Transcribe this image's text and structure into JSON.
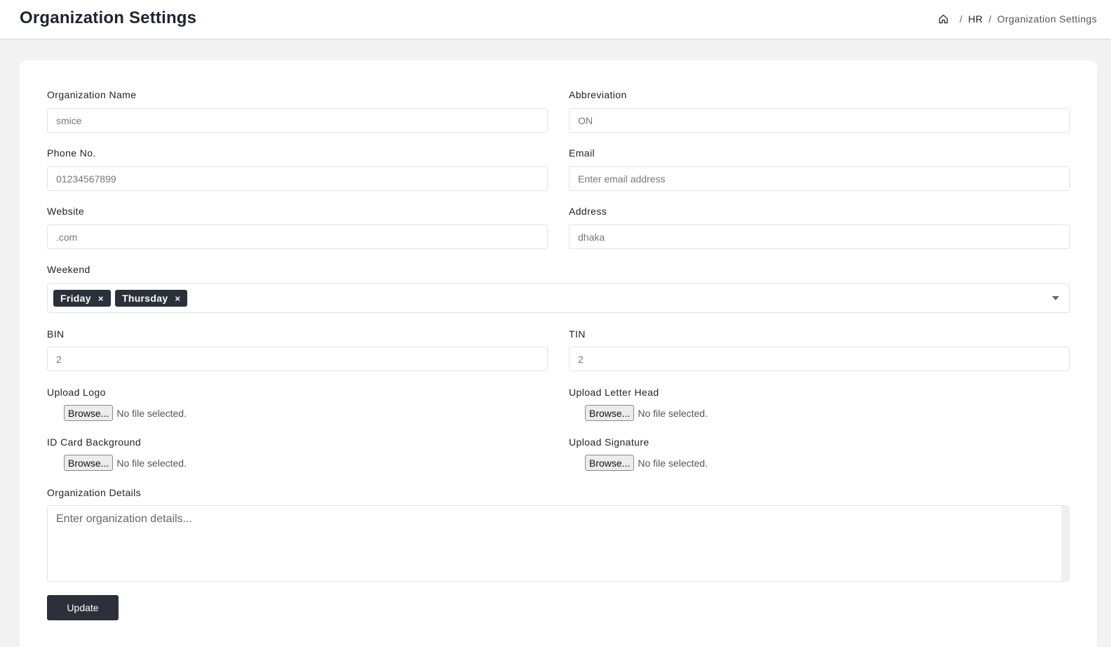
{
  "header": {
    "title": "Organization Settings",
    "breadcrumb": {
      "home_icon": "home-icon",
      "sep": "/",
      "section": "HR",
      "current": "Organization Settings"
    }
  },
  "form": {
    "org_name": {
      "label": "Organization Name",
      "placeholder": "smice"
    },
    "abbreviation": {
      "label": "Abbreviation",
      "placeholder": "ON"
    },
    "phone": {
      "label": "Phone No.",
      "placeholder": "01234567899"
    },
    "email": {
      "label": "Email",
      "placeholder": "Enter email address"
    },
    "website": {
      "label": "Website",
      "placeholder": ".com"
    },
    "address": {
      "label": "Address",
      "placeholder": "dhaka"
    },
    "weekend": {
      "label": "Weekend",
      "tags": [
        "Friday",
        "Thursday"
      ],
      "remove_glyph": "×"
    },
    "bin": {
      "label": "BIN",
      "placeholder": "2"
    },
    "tin": {
      "label": "TIN",
      "placeholder": "2"
    },
    "upload_logo": {
      "label": "Upload Logo",
      "button": "Browse...",
      "status": "No file selected."
    },
    "upload_letter_head": {
      "label": "Upload Letter Head",
      "button": "Browse...",
      "status": "No file selected."
    },
    "id_card_bg": {
      "label": "ID Card Background",
      "button": "Browse...",
      "status": "No file selected."
    },
    "upload_signature": {
      "label": "Upload Signature",
      "button": "Browse...",
      "status": "No file selected."
    },
    "details": {
      "label": "Organization Details",
      "placeholder": "Enter organization details..."
    },
    "submit_label": "Update"
  },
  "colors": {
    "primary": "#2b303b",
    "background": "#f2f2f2",
    "card": "#ffffff",
    "border": "#e1e3e6"
  }
}
